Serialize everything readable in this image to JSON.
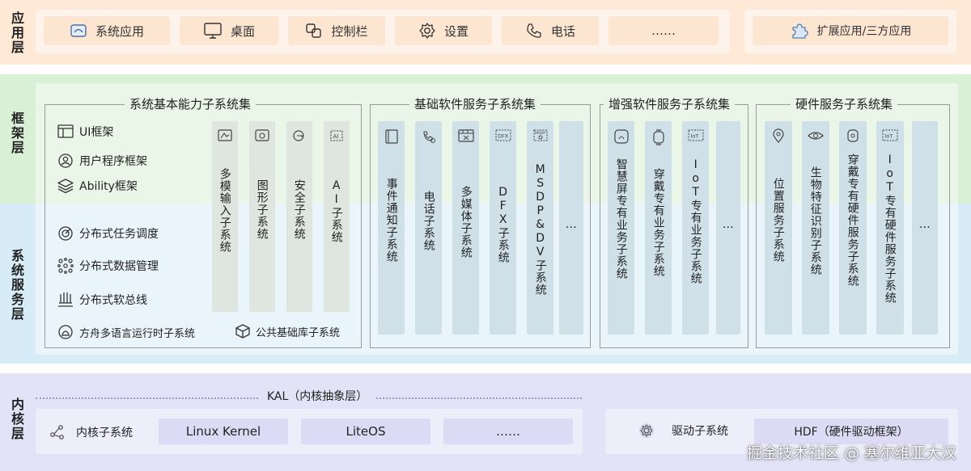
{
  "layers": {
    "app": "应用层",
    "framework": "框架层",
    "system_service": "系统服务层",
    "kernel": "内核层"
  },
  "app_layer": {
    "items": [
      {
        "label": "系统应用",
        "icon": "system-app-icon"
      },
      {
        "label": "桌面",
        "icon": "monitor-icon"
      },
      {
        "label": "控制栏",
        "icon": "control-bar-icon"
      },
      {
        "label": "设置",
        "icon": "gear-icon"
      },
      {
        "label": "电话",
        "icon": "phone-icon"
      },
      {
        "label": "……",
        "icon": ""
      }
    ],
    "extension": {
      "label": "扩展应用/三方应用",
      "icon": "puzzle-icon"
    }
  },
  "groups": {
    "basic": {
      "title": "系统基本能力子系统集",
      "frameworks": [
        {
          "label": "UI框架",
          "icon": "ui-frame-icon"
        },
        {
          "label": "用户程序框架",
          "icon": "user-program-icon"
        },
        {
          "label": "Ability框架",
          "icon": "layers-icon"
        }
      ],
      "services": [
        {
          "label": "分布式任务调度",
          "icon": "task-schedule-icon"
        },
        {
          "label": "分布式数据管理",
          "icon": "data-manage-icon"
        },
        {
          "label": "分布式软总线",
          "icon": "soft-bus-icon"
        }
      ],
      "bottom": [
        {
          "label": "方舟多语言运行时子系统",
          "icon": "ark-runtime-icon"
        },
        {
          "label": "公共基础库子系统",
          "icon": "cube-icon"
        }
      ],
      "columns": [
        {
          "label": "多模输入子系统",
          "icon": "input-icon"
        },
        {
          "label": "图形子系统",
          "icon": "graphics-icon"
        },
        {
          "label": "安全子系统",
          "icon": "key-icon"
        },
        {
          "label": "AI子系统",
          "icon": "ai-icon"
        }
      ]
    },
    "software": {
      "title": "基础软件服务子系统集",
      "columns": [
        {
          "label": "事件通知子系统",
          "icon": "event-icon"
        },
        {
          "label": "电话子系统",
          "icon": "telephony-icon"
        },
        {
          "label": "多媒体子系统",
          "icon": "media-icon"
        },
        {
          "label": "DFX子系统",
          "icon": "dfx-icon"
        },
        {
          "label": "MSDP&DV子系统",
          "icon": "msdp-icon"
        },
        {
          "label": "…",
          "icon": ""
        }
      ]
    },
    "enhanced": {
      "title": "增强软件服务子系统集",
      "columns": [
        {
          "label": "智慧屏专有业务子系统",
          "icon": "smart-screen-icon"
        },
        {
          "label": "穿戴专有业务子系统",
          "icon": "watch-icon"
        },
        {
          "label": "IoT专有业务子系统",
          "icon": "iot-icon"
        },
        {
          "label": "…",
          "icon": ""
        }
      ]
    },
    "hardware": {
      "title": "硬件服务子系统集",
      "columns": [
        {
          "label": "位置服务子系统",
          "icon": "location-icon"
        },
        {
          "label": "生物特征识别子系统",
          "icon": "eye-icon"
        },
        {
          "label": "穿戴专有硬件服务子系统",
          "icon": "wearable-icon"
        },
        {
          "label": "IoT专有硬件服务子系统",
          "icon": "iot-chip-icon"
        },
        {
          "label": "…",
          "icon": ""
        }
      ]
    }
  },
  "kernel_layer": {
    "kal": "KAL（内核抽象层）",
    "kernel_subsystem": "内核子系统",
    "kernels": [
      "Linux Kernel",
      "LiteOS",
      "……"
    ],
    "driver_subsystem": "驱动子系统",
    "hdf": "HDF（硬件驱动框架）"
  },
  "watermark": "掘金技术社区 @ 塞尔维亚大汉",
  "colors": {
    "app_band": "#fde9d6",
    "framework_band": "#d9f0d6",
    "service_band": "#d7ecf7",
    "kernel_band": "#e3e2f7"
  }
}
